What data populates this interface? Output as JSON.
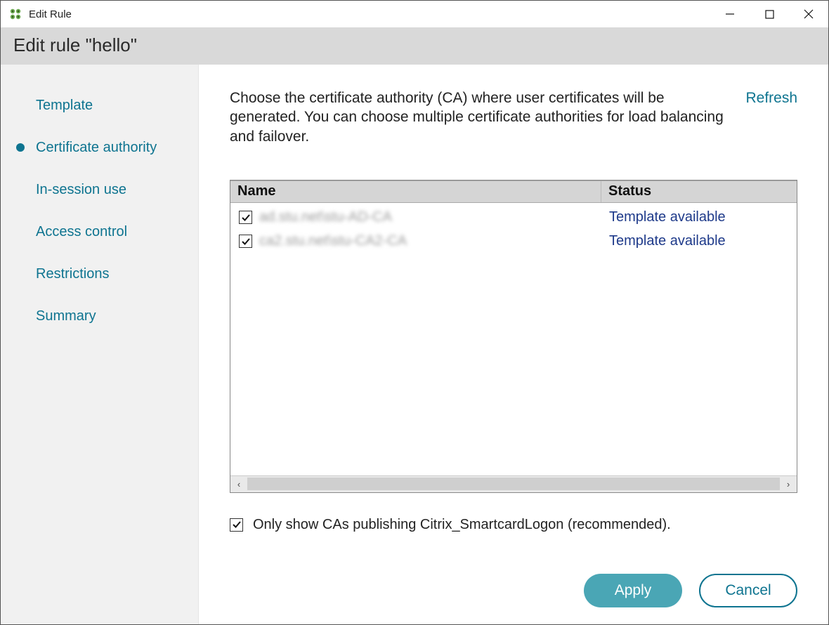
{
  "window": {
    "title": "Edit Rule"
  },
  "header": {
    "title": "Edit rule \"hello\""
  },
  "sidebar": {
    "items": [
      {
        "label": "Template",
        "active": false
      },
      {
        "label": "Certificate authority",
        "active": true
      },
      {
        "label": "In-session use",
        "active": false
      },
      {
        "label": "Access control",
        "active": false
      },
      {
        "label": "Restrictions",
        "active": false
      },
      {
        "label": "Summary",
        "active": false
      }
    ]
  },
  "main": {
    "description": "Choose the certificate authority (CA) where user certificates will be generated. You can choose multiple certificate authorities for load balancing and failover.",
    "refresh_label": "Refresh",
    "table": {
      "headers": {
        "name": "Name",
        "status": "Status"
      },
      "rows": [
        {
          "checked": true,
          "name": "ad.stu.net\\stu-AD-CA",
          "status": "Template available"
        },
        {
          "checked": true,
          "name": "ca2.stu.net\\stu-CA2-CA",
          "status": "Template available"
        }
      ]
    },
    "filter": {
      "checked": true,
      "label": "Only show CAs publishing Citrix_SmartcardLogon (recommended)."
    }
  },
  "buttons": {
    "apply": "Apply",
    "cancel": "Cancel"
  }
}
